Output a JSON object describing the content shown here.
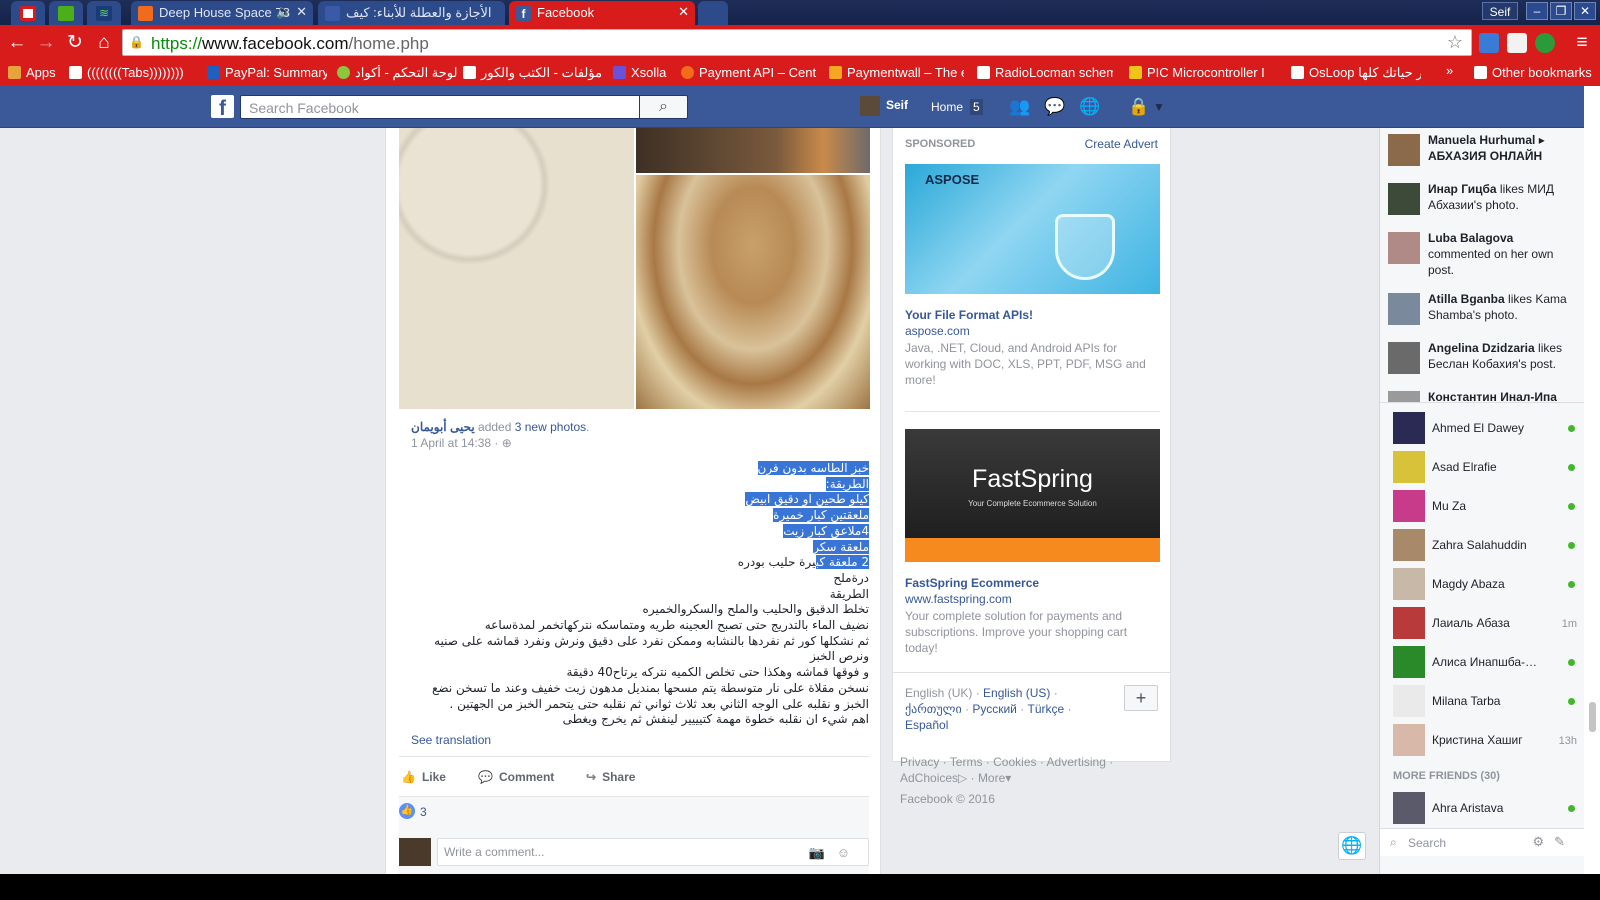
{
  "browser": {
    "tabs": [
      {
        "title": "Deep House Space 78",
        "active": false,
        "audio": true
      },
      {
        "title": "الأجازة والعطلة للأبناء: كيف",
        "active": false
      },
      {
        "title": "Facebook",
        "active": true
      }
    ],
    "profile_name": "Seif",
    "window_buttons": [
      "–",
      "❐",
      "✕"
    ],
    "url_scheme": "https://",
    "url_host": "www.facebook.com",
    "url_path": "/home.php",
    "bookmarks": [
      {
        "label": "Apps",
        "icon": "apps-grid-icon",
        "color": "#e8a33d"
      },
      {
        "label": "((((((((Tabs))))))))",
        "icon": "folder-icon",
        "color": "#ffffff"
      },
      {
        "label": "PayPal: Summary",
        "icon": "paypal-icon",
        "color": "#1f5fbf"
      },
      {
        "label": "لوحة التحكم - أكواد",
        "icon": "akwad-icon",
        "color": "#8cc63f"
      },
      {
        "label": "مؤلفات - الكتب والكور",
        "icon": "speaker-icon",
        "color": "#ffffff"
      },
      {
        "label": "Xsolla",
        "icon": "xsolla-icon",
        "color": "#6a52d8"
      },
      {
        "label": "Payment API – Centi",
        "icon": "centili-icon",
        "color": "#f26c1a"
      },
      {
        "label": "Paymentwall – The e",
        "icon": "paymentwall-icon",
        "color": "#f5a623"
      },
      {
        "label": "RadioLocman schem",
        "icon": "radiolocman-icon",
        "color": "#ffffff"
      },
      {
        "label": "PIC Microcontroller I",
        "icon": "pic-icon",
        "color": "#f0c419"
      },
      {
        "label": "OsLoop خبر حياتك كلها",
        "icon": "osloop-icon",
        "color": "#ffffff"
      },
      {
        "label": "Other bookmarks",
        "icon": "folder-icon",
        "color": "#ffffff"
      }
    ]
  },
  "fb_header": {
    "search_placeholder": "Search Facebook",
    "user_name": "Seif",
    "home_label": "Home",
    "home_count": "5"
  },
  "post": {
    "author": "يحيى أبويمان",
    "action_text": "added",
    "photos_link": "3 new photos",
    "date": "1 April at 14:38 · ",
    "lines_selected": [
      "خبز الطاسه بدون فرن",
      "الطريقة:",
      "كيلو طحين او دقيق ابيض",
      "ملعقتين كبار خميرة",
      "4ملاعق كبار زيت",
      "ملعقة سكر"
    ],
    "line_partial_sel": "2 ملعقة كب",
    "line_partial_rest": "يرة حليب بودره",
    "lines": [
      "درةملح",
      "الطريقة",
      "تخلط الدقيق والحليب والملح والسكروالخميره",
      "نضيف الماء بالتدريج حتى تصبح العجينه طريه ومتماسكه نتركهاتخمر لمدةساعه",
      "ثم نشكلها كور ثم نفردها بالنشابه وممكن نفرد على دقيق ونرش ونفرد قماشه على صنيه",
      "ونرص الخبز",
      "و فوقها قماشه وهكذا حتى تخلص الكميه نتركه يرتاح40 دقيقة",
      "نسخن مقلاة على نار متوسطة يتم مسحها بمنديل مدهون زيت خفيف وعند ما تسخن نضع",
      "الخبز و نقلبه على الوجه الثاني بعد ثلاث ثواني ثم نقلبه حتى يتحمر الخبز من الجهتين .",
      "اهم شيء ان نقلبه خطوة مهمة كتيييير لينفش ثم يخرج ويغطى"
    ],
    "see_translation": "See translation",
    "like_label": "Like",
    "comment_label": "Comment",
    "share_label": "Share",
    "like_count": "3",
    "comment_placeholder": "Write a comment..."
  },
  "ads": {
    "sponsored_label": "SPONSORED",
    "create_advert": "Create Advert",
    "ad1": {
      "brand": "ASPOSE",
      "title": "Your File Format APIs!",
      "url": "aspose.com",
      "desc": "Java, .NET, Cloud, and Android APIs for working with DOC, XLS, PPT, PDF, MSG and more!"
    },
    "ad2": {
      "brand": "FastSpring",
      "tagline": "Your Complete Ecommerce Solution",
      "title": "FastSpring Ecommerce",
      "url": "www.fastspring.com",
      "desc": "Your complete solution for payments and subscriptions. Improve your shopping cart today!"
    }
  },
  "languages": {
    "current": "English (UK)",
    "others": [
      "English (US)",
      "ქართული",
      "Русский",
      "Türkçe",
      "Español"
    ],
    "plus": "+"
  },
  "footer": {
    "links": [
      "Privacy",
      "Terms",
      "Cookies",
      "Advertising",
      "AdChoices",
      "More"
    ],
    "copyright": "Facebook © 2016"
  },
  "ticker": [
    {
      "name": "Manuela Hurhumal",
      "text": "▸",
      "name2": "АБХАЗИЯ ОНЛАЙН",
      "avatar_color": "#8a6a4a"
    },
    {
      "name": "Инар Гицба",
      "text": " likes МИД Абхазии's photo.",
      "avatar_color": "#3d4a3a"
    },
    {
      "name": "Luba Balagova",
      "text": " commented on her own post.",
      "avatar_color": "#b08a86"
    },
    {
      "name": "Atilla Bganba",
      "text": " likes Kama Shamba's photo.",
      "avatar_color": "#7a8a9c"
    },
    {
      "name": "Angelina Dzidzaria",
      "text": " likes Беслан Кобахия's post.",
      "avatar_color": "#6a6a6a"
    },
    {
      "name": "Константин Инал-Ипа",
      "text": "",
      "avatar_color": "#9a9a9a"
    }
  ],
  "chat": {
    "online": [
      {
        "name": "Ahmed El Dawey",
        "status": "online",
        "avatar_color": "#2a2a55"
      },
      {
        "name": "Asad Elrafie",
        "status": "online",
        "avatar_color": "#d8c23a"
      },
      {
        "name": "Mu Za",
        "status": "online",
        "avatar_color": "#c83a8a"
      },
      {
        "name": "Zahra Salahuddin",
        "status": "online",
        "avatar_color": "#a88a6a"
      },
      {
        "name": "Magdy Abaza",
        "status": "online",
        "avatar_color": "#c8b8a8"
      },
      {
        "name": "Лаиаль Абаза",
        "time": "1m",
        "avatar_color": "#b83a3a"
      },
      {
        "name": "Алиса Инапшба-Ка...",
        "status": "online",
        "avatar_color": "#2a8a2a"
      },
      {
        "name": "Milana Tarba",
        "status": "online",
        "avatar_color": "#eaeaea"
      },
      {
        "name": "Кристина Хашиг",
        "time": "13h",
        "avatar_color": "#d8b8a8"
      }
    ],
    "more_friends": "MORE FRIENDS (30)",
    "more": [
      {
        "name": "Ahra Aristava",
        "status": "online",
        "avatar_color": "#5a5a6a"
      }
    ],
    "search_placeholder": "Search"
  }
}
